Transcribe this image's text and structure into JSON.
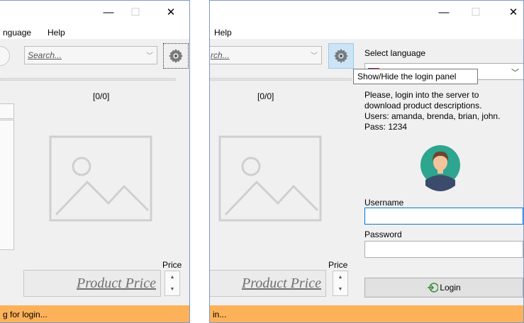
{
  "window_left": {
    "menu": {
      "language": "nguage",
      "help": "Help"
    },
    "search": {
      "placeholder": "Search..."
    },
    "counter": "[0/0]",
    "price_label": "Price",
    "price_value": "Product Price",
    "status": "g for login..."
  },
  "window_right": {
    "menu": {
      "help": "Help"
    },
    "search": {
      "placeholder": "rch..."
    },
    "counter": "[0/0]",
    "price_label": "Price",
    "price_value": "Product Price",
    "status": "in...",
    "login_panel": {
      "select_language_label": "Select language",
      "tooltip": "Show/Hide the login panel",
      "instructions": [
        "Please, login into the server to",
        "download product descriptions.",
        "Users: amanda, brenda, brian, john.",
        "Pass: 1234"
      ],
      "username_label": "Username",
      "password_label": "Password",
      "login_button": "Login"
    }
  },
  "titlebar_buttons": {
    "minimize": "—",
    "maximize": "☐",
    "close": "✕"
  },
  "colors": {
    "status_bar": "#fdb25a",
    "gear_active": "#cce4f7",
    "avatar_bg": "#2ea58f"
  },
  "icons": [
    "gear-icon",
    "image-placeholder-icon",
    "avatar-icon",
    "login-icon",
    "us-flag-icon",
    "chevron-down-icon"
  ]
}
